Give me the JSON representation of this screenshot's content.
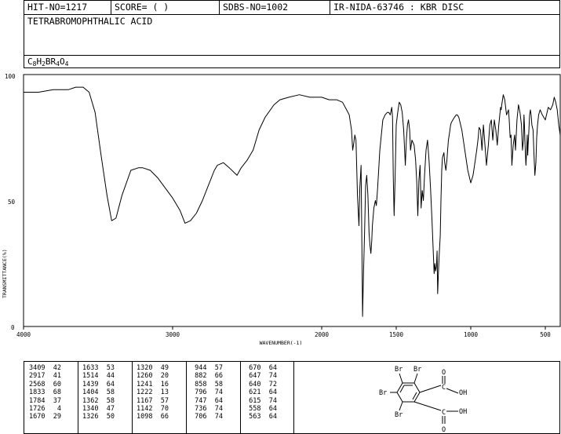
{
  "header": {
    "hit_no": "HIT-NO=1217",
    "score": "SCORE=  (   )",
    "sdbs_no": "SDBS-NO=1002",
    "ir_info": "IR-NIDA-63746 : KBR DISC"
  },
  "compound": {
    "name": "TETRABROMOPHTHALIC ACID",
    "formula_parts": [
      {
        "t": "C",
        "sub": false
      },
      {
        "t": "8",
        "sub": true
      },
      {
        "t": "H",
        "sub": false
      },
      {
        "t": "2",
        "sub": true
      },
      {
        "t": "BR",
        "sub": false
      },
      {
        "t": "4",
        "sub": true
      },
      {
        "t": "O",
        "sub": false
      },
      {
        "t": "4",
        "sub": true
      }
    ]
  },
  "chart_data": {
    "type": "line",
    "xlabel": "WAVENUMBER(-1)",
    "ylabel": "TRANSMITTANCE(%)",
    "xlim": [
      4000,
      400
    ],
    "ylim": [
      0,
      100
    ],
    "x_ticks": [
      4000,
      3000,
      2000,
      1500,
      1000,
      500
    ],
    "y_ticks": [
      0,
      50,
      100
    ],
    "series": [
      {
        "x": [
          4000,
          3900,
          3800,
          3700,
          3650,
          3600,
          3560,
          3520,
          3480,
          3440,
          3409,
          3380,
          3340,
          3280,
          3230,
          3200,
          3150,
          3100,
          3050,
          3000,
          2950,
          2917,
          2880,
          2840,
          2800,
          2760,
          2720,
          2700,
          2660,
          2620,
          2568,
          2540,
          2500,
          2460,
          2420,
          2380,
          2320,
          2280,
          2220,
          2150,
          2080,
          2000,
          1950,
          1900,
          1860,
          1833,
          1815,
          1800,
          1792,
          1784,
          1778,
          1770,
          1760,
          1750,
          1744,
          1736,
          1730,
          1726,
          1720,
          1712,
          1705,
          1698,
          1690,
          1682,
          1676,
          1670,
          1664,
          1660,
          1650,
          1640,
          1633,
          1625,
          1610,
          1590,
          1575,
          1560,
          1550,
          1540,
          1530,
          1525,
          1520,
          1514,
          1508,
          1500,
          1490,
          1480,
          1470,
          1460,
          1450,
          1439,
          1432,
          1425,
          1418,
          1410,
          1404,
          1395,
          1380,
          1370,
          1362,
          1355,
          1348,
          1340,
          1333,
          1326,
          1318,
          1310,
          1300,
          1290,
          1280,
          1270,
          1260,
          1253,
          1246,
          1241,
          1236,
          1230,
          1226,
          1222,
          1218,
          1212,
          1205,
          1200,
          1195,
          1190,
          1180,
          1175,
          1167,
          1160,
          1155,
          1150,
          1142,
          1135,
          1130,
          1120,
          1110,
          1098,
          1090,
          1080,
          1060,
          1040,
          1020,
          1000,
          985,
          975,
          960,
          950,
          944,
          935,
          925,
          915,
          905,
          895,
          882,
          872,
          862,
          852,
          842,
          832,
          822,
          812,
          800,
          796,
          792,
          782,
          772,
          760,
          747,
          742,
          736,
          730,
          724,
          715,
          706,
          700,
          690,
          680,
          670,
          660,
          653,
          647,
          643,
          640,
          636,
          630,
          625,
          621,
          618,
          615,
          610,
          605,
          600,
          595,
          590,
          582,
          576,
          570,
          563,
          558,
          552,
          545,
          535,
          520,
          500,
          480,
          465,
          450,
          440,
          430,
          420,
          410,
          400
        ],
        "y": [
          93,
          93,
          94,
          94,
          95,
          95,
          93,
          85,
          68,
          52,
          42,
          43,
          52,
          62,
          63,
          63,
          62,
          59,
          55,
          51,
          46,
          41,
          42,
          45,
          50,
          56,
          62,
          64,
          65,
          63,
          60,
          63,
          66,
          70,
          78,
          83,
          88,
          90,
          91,
          92,
          91,
          91,
          90,
          90,
          89,
          86,
          84,
          78,
          70,
          73,
          76,
          74,
          52,
          40,
          55,
          64,
          30,
          4,
          20,
          38,
          56,
          60,
          52,
          37,
          32,
          29,
          34,
          40,
          47,
          50,
          48,
          55,
          70,
          82,
          84,
          85,
          85,
          84,
          87,
          83,
          60,
          44,
          58,
          80,
          85,
          89,
          88,
          85,
          78,
          64,
          74,
          80,
          82,
          78,
          70,
          74,
          72,
          66,
          57,
          44,
          58,
          64,
          47,
          54,
          50,
          60,
          70,
          74,
          66,
          55,
          42,
          32,
          21,
          25,
          22,
          24,
          30,
          13,
          20,
          28,
          36,
          50,
          62,
          67,
          69,
          65,
          62,
          66,
          70,
          74,
          77,
          80,
          81,
          82,
          83,
          84,
          84,
          83,
          78,
          70,
          62,
          57,
          60,
          64,
          70,
          75,
          79,
          78,
          70,
          80,
          72,
          64,
          72,
          80,
          82,
          74,
          82,
          78,
          72,
          80,
          87,
          86,
          88,
          92,
          90,
          84,
          86,
          82,
          75,
          76,
          64,
          72,
          76,
          70,
          82,
          88,
          85,
          80,
          70,
          74,
          84,
          80,
          72,
          64,
          70,
          76,
          68,
          72,
          78,
          84,
          86,
          84,
          80,
          78,
          68,
          60,
          65,
          75,
          80,
          84,
          86,
          84,
          82,
          87,
          86,
          88,
          91,
          89,
          86,
          80,
          76
        ]
      }
    ]
  },
  "peak_table": {
    "columns": [
      [
        [
          "3409",
          "42"
        ],
        [
          "2917",
          "41"
        ],
        [
          "2568",
          "60"
        ],
        [
          "1833",
          "68"
        ],
        [
          "1784",
          "37"
        ],
        [
          "1726",
          "4"
        ],
        [
          "1670",
          "29"
        ]
      ],
      [
        [
          "1633",
          "53"
        ],
        [
          "1514",
          "44"
        ],
        [
          "1439",
          "64"
        ],
        [
          "1404",
          "58"
        ],
        [
          "1362",
          "58"
        ],
        [
          "1340",
          "47"
        ],
        [
          "1326",
          "50"
        ]
      ],
      [
        [
          "1320",
          "49"
        ],
        [
          "1260",
          "20"
        ],
        [
          "1241",
          "16"
        ],
        [
          "1222",
          "13"
        ],
        [
          "1167",
          "57"
        ],
        [
          "1142",
          "70"
        ],
        [
          "1098",
          "66"
        ]
      ],
      [
        [
          "944",
          "57"
        ],
        [
          "882",
          "66"
        ],
        [
          "858",
          "58"
        ],
        [
          "796",
          "74"
        ],
        [
          "747",
          "64"
        ],
        [
          "736",
          "74"
        ],
        [
          "706",
          "74"
        ]
      ],
      [
        [
          "670",
          "64"
        ],
        [
          "647",
          "74"
        ],
        [
          "640",
          "72"
        ],
        [
          "621",
          "64"
        ],
        [
          "615",
          "74"
        ],
        [
          "558",
          "64"
        ],
        [
          "563",
          "64"
        ]
      ]
    ]
  },
  "structure": {
    "br_label": "Br",
    "oh_label": "OH",
    "o_label": "O",
    "c_label": "C"
  }
}
